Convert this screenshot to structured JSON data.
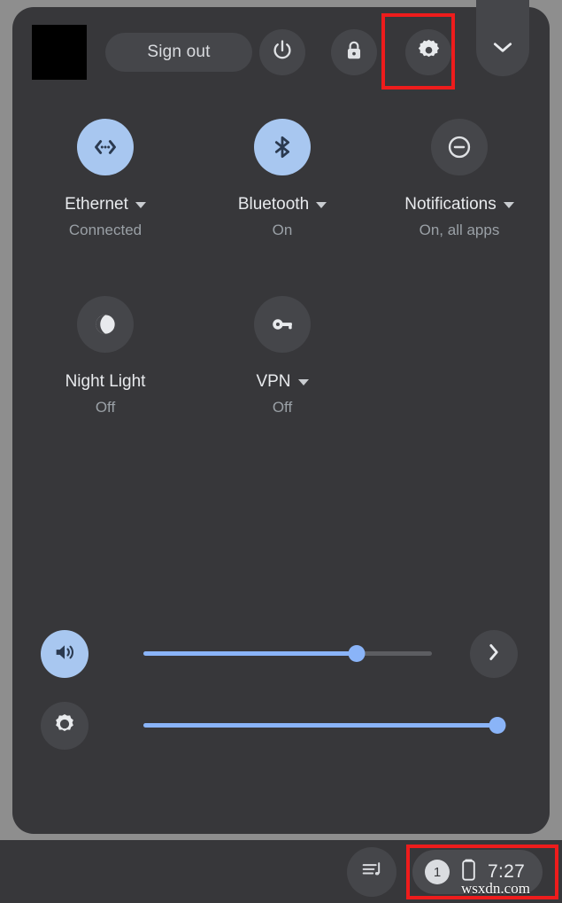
{
  "window": {
    "os": "ChromeOS",
    "surface": "Quick Settings panel"
  },
  "top_row": {
    "avatar_name": "user-avatar",
    "sign_out_label": "Sign out",
    "power_icon": "power-icon",
    "lock_icon": "lock-icon",
    "settings_icon": "gear-icon",
    "collapse_icon": "chevron-down-icon"
  },
  "tiles": [
    {
      "id": "ethernet",
      "icon": "ethernet-icon",
      "label": "Ethernet",
      "status": "Connected",
      "enabled": true,
      "has_caret": true
    },
    {
      "id": "bluetooth",
      "icon": "bluetooth-icon",
      "label": "Bluetooth",
      "status": "On",
      "enabled": true,
      "has_caret": true
    },
    {
      "id": "notifications",
      "icon": "do-not-disturb-icon",
      "label": "Notifications",
      "status": "On, all apps",
      "enabled": false,
      "has_caret": true
    },
    {
      "id": "night-light",
      "icon": "moon-icon",
      "label": "Night Light",
      "status": "Off",
      "enabled": false,
      "has_caret": false
    },
    {
      "id": "vpn",
      "icon": "key-icon",
      "label": "VPN",
      "status": "Off",
      "enabled": false,
      "has_caret": true
    }
  ],
  "sliders": {
    "volume": {
      "icon": "volume-icon",
      "value_percent": 74,
      "enabled": true,
      "expand_icon": "chevron-right-icon"
    },
    "brightness": {
      "icon": "brightness-icon",
      "value_percent": 100,
      "enabled": false
    }
  },
  "shelf": {
    "media_icon": "media-playlist-icon",
    "status_area": {
      "notification_count": "1",
      "battery_icon": "battery-icon",
      "clock": "7:27"
    }
  },
  "annotations": {
    "highlight_color": "#ee1c1c",
    "targets": [
      "settings-gear-button",
      "shelf-status-area"
    ]
  },
  "watermark": "wsxdn.com",
  "colors": {
    "panel_bg": "#37373a",
    "desktop_bg": "#8e8e8e",
    "accent_blue": "#a8c7f0",
    "slider_blue": "#8ab4f8",
    "tile_off_bg": "#45464a",
    "text_primary": "#e8eaed",
    "text_secondary": "#9aa0a6"
  }
}
